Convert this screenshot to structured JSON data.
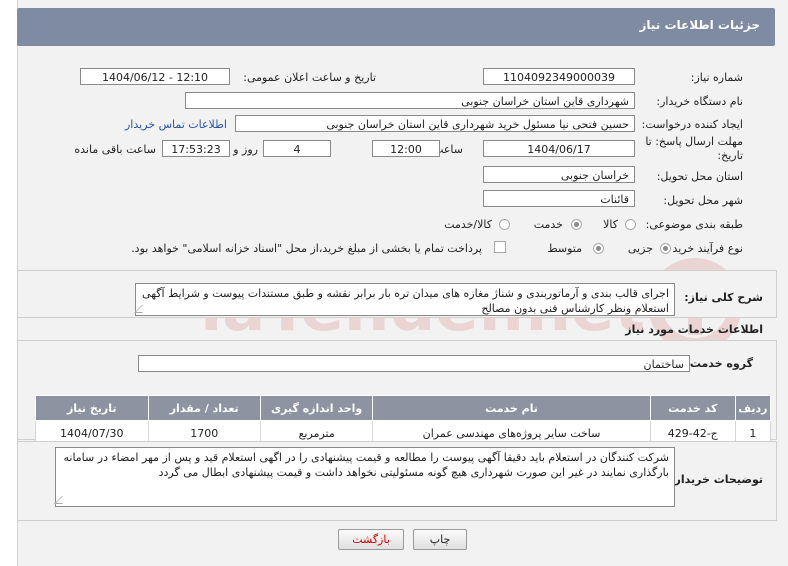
{
  "header": {
    "title": "جزئیات اطلاعات نیاز"
  },
  "form": {
    "need_number_label": "شماره نیاز:",
    "need_number": "1104092349000039",
    "announce_label": "تاریخ و ساعت اعلان عمومی:",
    "announce_value": "1404/06/12 - 12:10",
    "buyer_org_label": "نام دستگاه خریدار:",
    "buyer_org": "شهرداری قاین استان خراسان جنوبی",
    "creator_label": "ایجاد کننده درخواست:",
    "creator": "حسین فتحی نیا مسئول خرید شهرداری قاین استان خراسان جنوبی",
    "contact_link": "اطلاعات تماس خریدار",
    "deadline_label": "مهلت ارسال پاسخ: تا تاریخ:",
    "deadline_date": "1404/06/17",
    "time_label": "ساعت",
    "deadline_time": "12:00",
    "days_value": "4",
    "days_label": "روز و",
    "remaining_value": "17:53:23",
    "remaining_label": "ساعت باقی مانده",
    "province_label": "استان محل تحویل:",
    "province": "خراسان جنوبی",
    "city_label": "شهر محل تحویل:",
    "city": "قائنات",
    "category_label": "طبقه بندی موضوعی:",
    "category_options": [
      "کالا",
      "خدمت",
      "کالا/خدمت"
    ],
    "category_selected": "خدمت",
    "process_label": "نوع فرآیند خرید :",
    "process_options": [
      "جزیی",
      "متوسط"
    ],
    "process_selected": "جزیی",
    "payment_note": "پرداخت تمام یا بخشی از مبلغ خرید،از محل \"اسناد خزانه اسلامی\" خواهد بود."
  },
  "description": {
    "label": "شرح کلی نیاز:",
    "text": "اجرای قالب بندی و آرماتوربندی و شناژ مغازه های میدان تره بار برابر نقشه و طبق مستندات پیوست و شرایط آگهی استعلام ونظر کارشناس فنی بدون مصالح"
  },
  "services": {
    "section_title": "اطلاعات خدمات مورد نیاز",
    "group_label": "گروه خدمت:",
    "group_value": "ساختمان",
    "columns": [
      "ردیف",
      "کد خدمت",
      "نام خدمت",
      "واحد اندازه گیری",
      "تعداد / مقدار",
      "تاریخ نیاز"
    ],
    "rows": [
      [
        "1",
        "ج-42-429",
        "ساخت سایر پروژه‌های مهندسی عمران",
        "مترمربع",
        "1700",
        "1404/07/30"
      ]
    ]
  },
  "buyer_notes": {
    "label": "توضیحات خریدار:",
    "text": "شرکت کنندگان در استعلام باید دقیقا آگهی پیوست را مطالعه و قیمت پیشنهادی را در اگهی استعلام قید و پس از مهر امضاء در سامانه بارگذاری نمایند در غیر این صورت شهرداری هیچ گونه مسئولیتی نخواهد داشت و قیمت پیشنهادی ابطال می گردد"
  },
  "buttons": {
    "print": "چاپ",
    "back": "بازگشت"
  },
  "watermark": {
    "text": "AriaTender.net"
  },
  "colors": {
    "header": "#7e8ba3",
    "table_header": "#8d93a0",
    "link": "#2a55a6",
    "back_button_text": "#cc0000"
  }
}
